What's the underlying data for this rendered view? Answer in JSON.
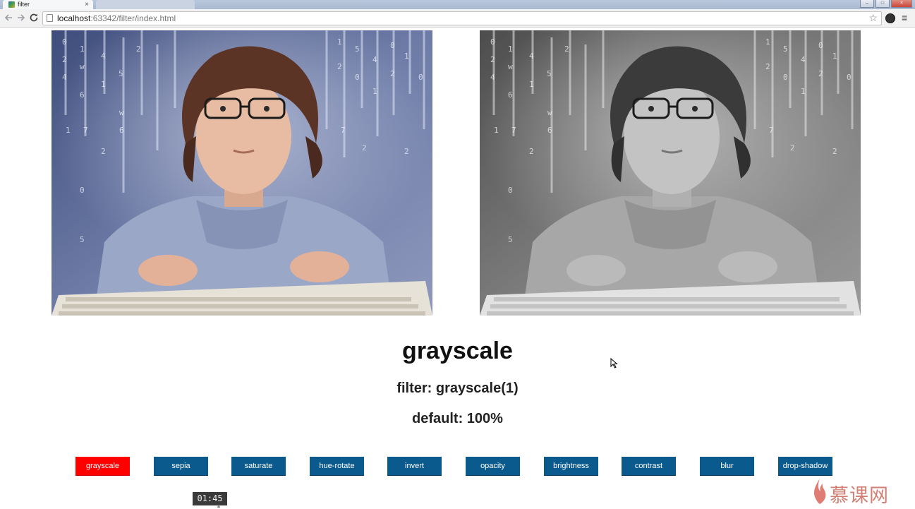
{
  "browser": {
    "tab_title": "filter",
    "tab_close": "×",
    "url_host": "localhost",
    "url_rest": ":63342/filter/index.html",
    "back_icon": "arrow-left-icon",
    "forward_icon": "arrow-right-icon",
    "reload_icon": "reload-icon",
    "bookmark_icon": "star-icon",
    "menu_icon": "hamburger-menu-icon",
    "win_min": "–",
    "win_max": "□",
    "win_close": "×"
  },
  "page": {
    "title": "grayscale",
    "filter_text": "filter: grayscale(1)",
    "default_text": "default: 100%",
    "accent_active": "#ff0000",
    "button_color": "#0a5a8e",
    "buttons": [
      {
        "label": "grayscale",
        "active": true
      },
      {
        "label": "sepia",
        "active": false
      },
      {
        "label": "saturate",
        "active": false
      },
      {
        "label": "hue-rotate",
        "active": false
      },
      {
        "label": "invert",
        "active": false
      },
      {
        "label": "opacity",
        "active": false
      },
      {
        "label": "brightness",
        "active": false
      },
      {
        "label": "contrast",
        "active": false
      },
      {
        "label": "blur",
        "active": false
      },
      {
        "label": "drop-shadow",
        "active": false
      }
    ]
  },
  "overlay": {
    "timer": "01:45",
    "watermark": "慕课网"
  }
}
